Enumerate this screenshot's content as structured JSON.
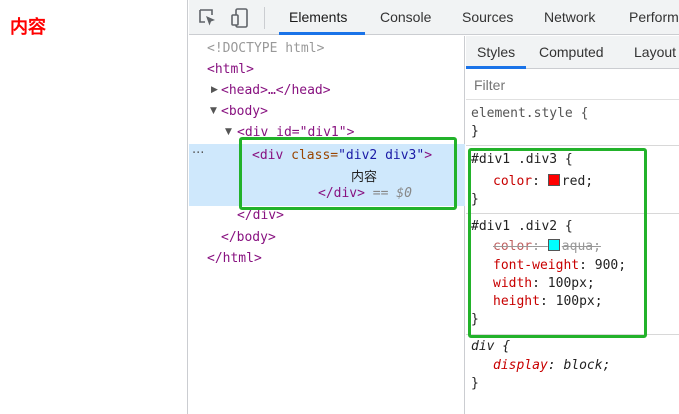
{
  "page": {
    "content_text": "内容"
  },
  "devtools": {
    "icons": {
      "inspect": "inspect-element-icon",
      "device": "device-toolbar-icon"
    },
    "tabs": [
      "Elements",
      "Console",
      "Sources",
      "Network",
      "Perform"
    ],
    "active_tab": "Elements",
    "dom": {
      "doctype": "<!DOCTYPE html>",
      "html_open": "<html>",
      "head_line": "<head>…</head>",
      "body_open": "<body>",
      "div1_open": "<div id=\"div1\">",
      "div2_tag": "<div",
      "div2_attr_name": " class=",
      "div2_attr_val": "\"div2 div3\"",
      "div2_close_bracket": ">",
      "div2_text": "内容",
      "div2_close": "</div>",
      "div2_eq": " == $0",
      "div1_close": "</div>",
      "body_close": "</body>",
      "html_close": "</html>",
      "ellipsis": "···"
    },
    "styles": {
      "tabs": [
        "Styles",
        "Computed",
        "Layout"
      ],
      "filter_placeholder": "Filter",
      "element_style_selector": "element.style {",
      "close_brace": "}",
      "rule1": {
        "selector": "#div1 .div3 {",
        "props": [
          {
            "name": "color",
            "value": "red;",
            "swatch": "#ff0000"
          }
        ]
      },
      "rule2": {
        "selector": "#div1 .div2 {",
        "props": [
          {
            "name": "color",
            "value": "aqua;",
            "swatch": "#00ffff",
            "overridden": true
          },
          {
            "name": "font-weight",
            "value": "900;"
          },
          {
            "name": "width",
            "value": "100px;"
          },
          {
            "name": "height",
            "value": "100px;"
          }
        ]
      },
      "ua_rule": {
        "selector": "div {",
        "props": [
          {
            "name": "display",
            "value": "block;"
          }
        ]
      }
    }
  },
  "colors": {
    "highlight_green": "#22b22a",
    "active_blue": "#1a73e8",
    "selection_bg": "#cfe8fc"
  }
}
